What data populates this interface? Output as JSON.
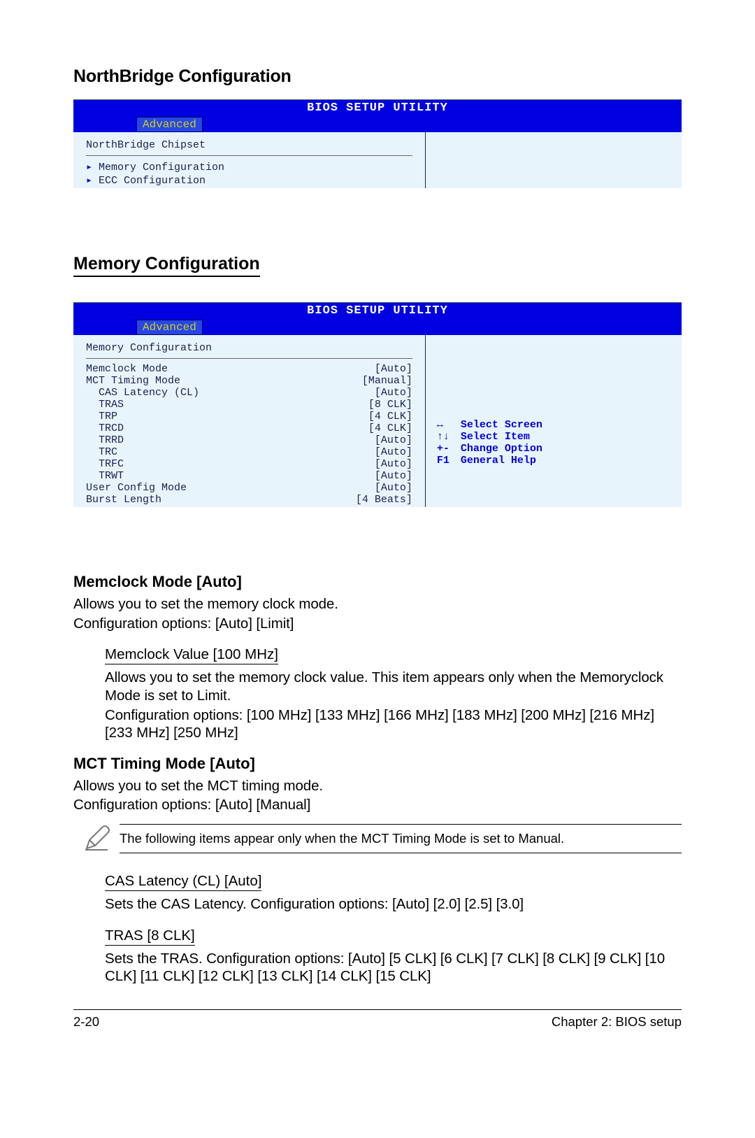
{
  "headings": {
    "northbridge": "NorthBridge Configuration",
    "memory_cfg": "Memory Configuration",
    "memclock_mode": "Memclock Mode [Auto]",
    "mct_timing": "MCT Timing Mode [Auto]",
    "memclock_value": "Memclock Value [100 MHz]",
    "cas_latency": "CAS Latency (CL) [Auto]",
    "tras": "TRAS [8 CLK]"
  },
  "bios1": {
    "title": "BIOS SETUP UTILITY",
    "tab": "Advanced",
    "section": "NorthBridge Chipset",
    "items": [
      {
        "label": "Memory Configuration"
      },
      {
        "label": "ECC Configuration"
      }
    ]
  },
  "bios2": {
    "title": "BIOS SETUP UTILITY",
    "tab": "Advanced",
    "section": "Memory Configuration",
    "rows": [
      {
        "label": "Memclock Mode",
        "value": "[Auto]",
        "indent": false
      },
      {
        "label": "MCT Timing Mode",
        "value": "[Manual]",
        "indent": false
      },
      {
        "label": "CAS Latency (CL)",
        "value": "[Auto]",
        "indent": true
      },
      {
        "label": "TRAS",
        "value": "[8 CLK]",
        "indent": true
      },
      {
        "label": "TRP",
        "value": "[4 CLK]",
        "indent": true
      },
      {
        "label": "TRCD",
        "value": "[4 CLK]",
        "indent": true
      },
      {
        "label": "TRRD",
        "value": "[Auto]",
        "indent": true
      },
      {
        "label": "TRC",
        "value": "[Auto]",
        "indent": true
      },
      {
        "label": "TRFC",
        "value": "[Auto]",
        "indent": true
      },
      {
        "label": "TRWT",
        "value": "[Auto]",
        "indent": true
      },
      {
        "label": "User Config Mode",
        "value": "[Auto]",
        "indent": false
      },
      {
        "label": "Burst Length",
        "value": "[4 Beats]",
        "indent": false
      }
    ],
    "help": [
      {
        "sym": "↔",
        "txt": "Select Screen"
      },
      {
        "sym": "↑↓",
        "txt": "Select Item"
      },
      {
        "sym": "+-",
        "txt": "Change Option"
      },
      {
        "sym": "F1",
        "txt": "General Help"
      }
    ]
  },
  "body": {
    "memclock_mode_p1": "Allows you to set the memory clock mode.",
    "memclock_mode_p2": "Configuration options: [Auto] [Limit]",
    "memclock_value_p1": "Allows you to set the memory clock value. This item appears only when the Memoryclock Mode is set to Limit.",
    "memclock_value_p2": "Configuration options: [100 MHz] [133 MHz] [166 MHz] [183 MHz] [200 MHz] [216 MHz] [233 MHz] [250 MHz]",
    "mct_p1": "Allows you to set the MCT timing mode.",
    "mct_p2": "Configuration options: [Auto] [Manual]",
    "note": "The following items appear only when the MCT Timing Mode is set to Manual.",
    "cas_p": "Sets the CAS Latency. Configuration options: [Auto] [2.0] [2.5] [3.0]",
    "tras_p": "Sets the TRAS. Configuration options: [Auto] [5 CLK] [6 CLK] [7 CLK] [8 CLK] [9 CLK] [10 CLK] [11 CLK] [12 CLK] [13 CLK] [14 CLK] [15 CLK]"
  },
  "footer": {
    "left": "2-20",
    "right": "Chapter 2: BIOS setup"
  }
}
